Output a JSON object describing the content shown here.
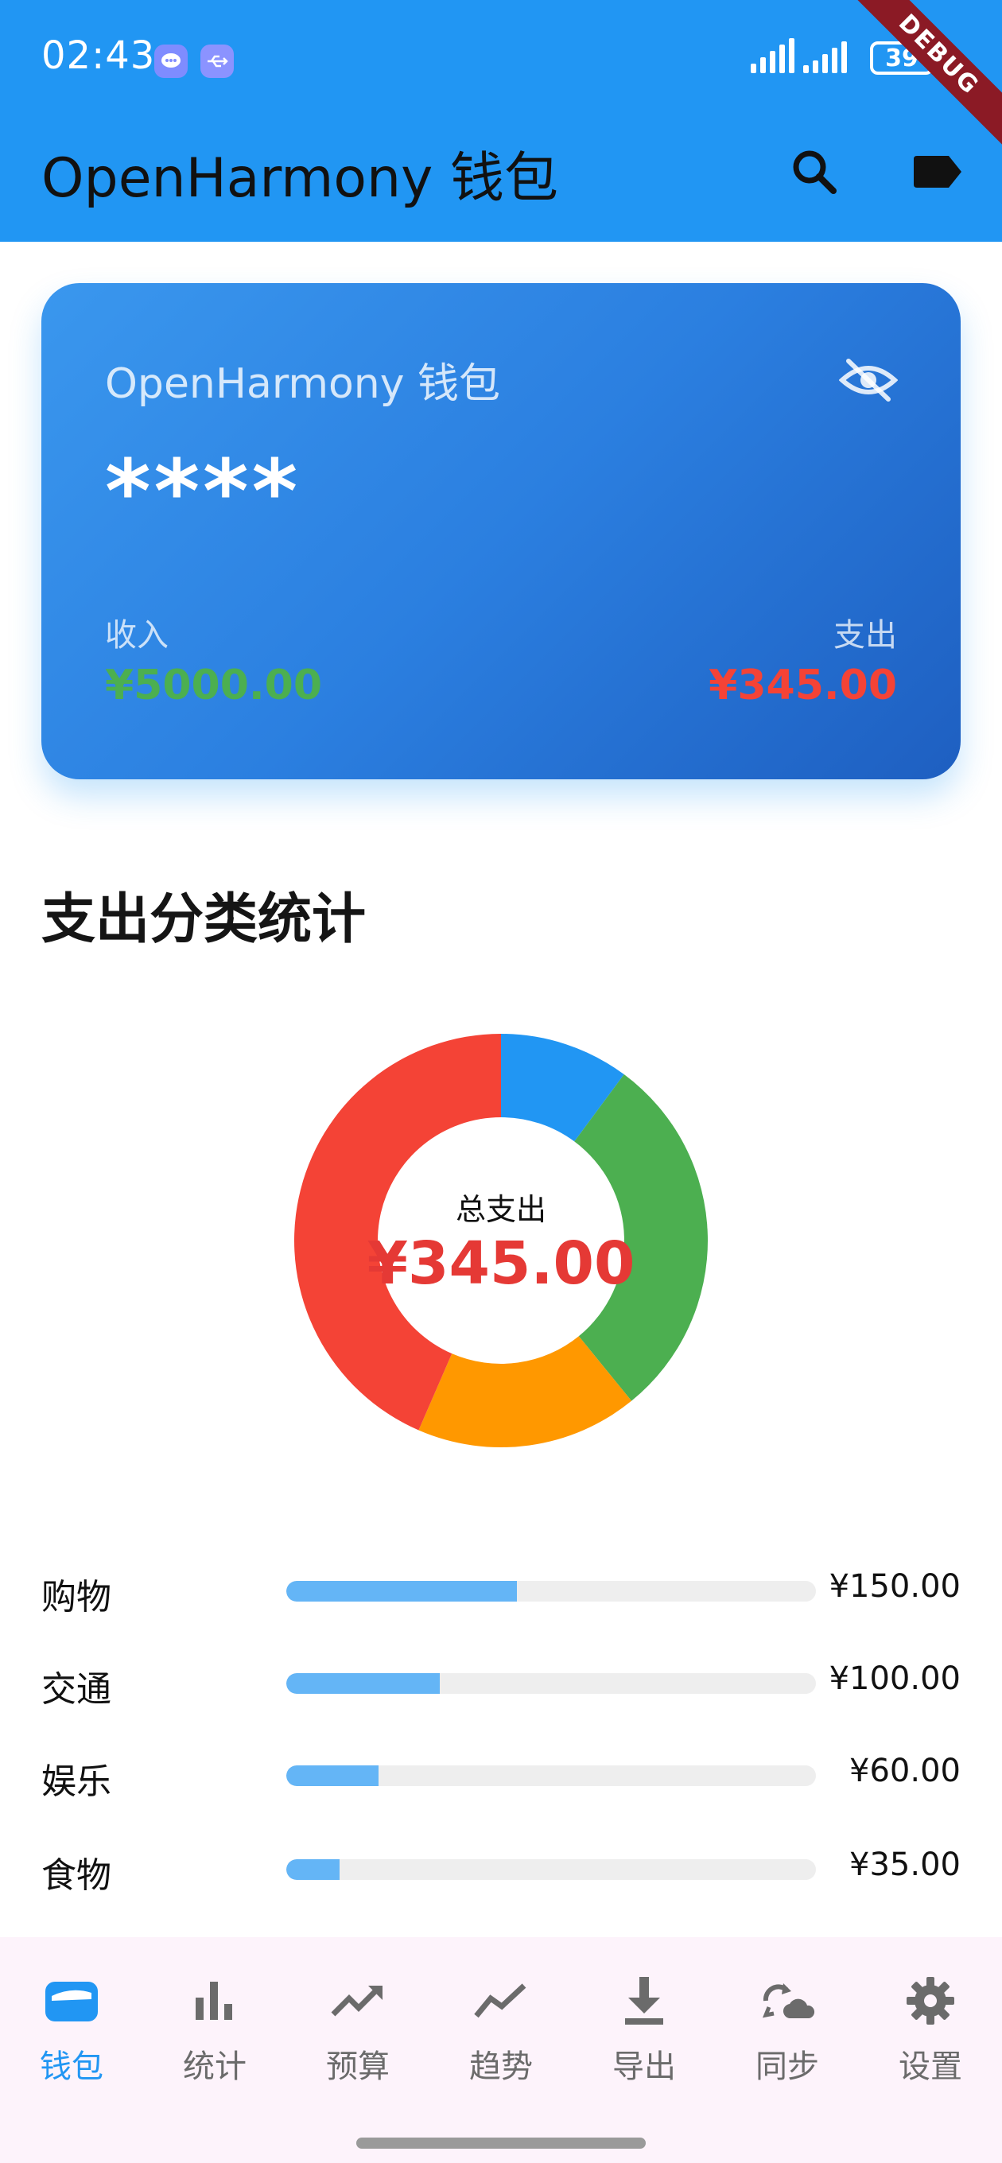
{
  "status_bar": {
    "time": "02:43",
    "battery": "39",
    "debug_banner": "DEBUG"
  },
  "app_bar": {
    "title": "OpenHarmony 钱包",
    "icons": [
      "search-icon",
      "label-icon"
    ]
  },
  "wallet_card": {
    "title": "OpenHarmony 钱包",
    "balance_masked": "****",
    "visibility_icon": "eye-off-icon",
    "income_label": "收入",
    "income_value": "¥5000.00",
    "expense_label": "支出",
    "expense_value": "¥345.00",
    "colors": {
      "income": "#4caf50",
      "expense": "#f44336",
      "card": "#2b7fe0"
    }
  },
  "section": {
    "title": "支出分类统计"
  },
  "chart_data": {
    "type": "pie",
    "center_label": "总支出",
    "center_value": "¥345.00",
    "slices": [
      {
        "value": 35,
        "color": "#2196f3"
      },
      {
        "value": 100,
        "color": "#4caf50"
      },
      {
        "value": 60,
        "color": "#ff9800"
      },
      {
        "value": 150,
        "color": "#f44336"
      }
    ]
  },
  "categories": [
    {
      "name": "购物",
      "amount": "¥150.00",
      "fraction": 0.435
    },
    {
      "name": "交通",
      "amount": "¥100.00",
      "fraction": 0.29
    },
    {
      "name": "娱乐",
      "amount": "¥60.00",
      "fraction": 0.174
    },
    {
      "name": "食物",
      "amount": "¥35.00",
      "fraction": 0.101
    }
  ],
  "bottom_nav": {
    "active_color": "#2196f3",
    "items": [
      {
        "label": "钱包",
        "icon": "wallet-icon",
        "active": true
      },
      {
        "label": "统计",
        "icon": "bar-chart-icon",
        "active": false
      },
      {
        "label": "预算",
        "icon": "trending-up-icon",
        "active": false
      },
      {
        "label": "趋势",
        "icon": "show-chart-icon",
        "active": false
      },
      {
        "label": "导出",
        "icon": "download-icon",
        "active": false
      },
      {
        "label": "同步",
        "icon": "sync-cloud-icon",
        "active": false
      },
      {
        "label": "设置",
        "icon": "settings-gear-icon",
        "active": false
      }
    ]
  }
}
